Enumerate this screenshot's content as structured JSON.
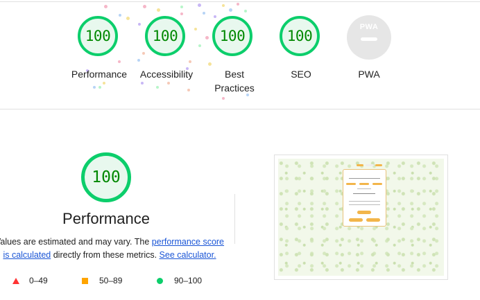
{
  "categories": [
    {
      "score": "100",
      "label": "Performance"
    },
    {
      "score": "100",
      "label": "Accessibility"
    },
    {
      "score": "100",
      "label": "Best Practices"
    },
    {
      "score": "100",
      "label": "SEO"
    }
  ],
  "pwa": {
    "badge": "PWA",
    "label": "PWA"
  },
  "performance": {
    "score": "100",
    "title": "Performance",
    "desc_part1": "Values are estimated and may vary. The ",
    "link1": "performance score is calculated",
    "desc_part2": " directly from these metrics. ",
    "link2": "See calculator."
  },
  "legend": [
    {
      "range": "0–49",
      "shape": "triangle",
      "color": "#ff3333"
    },
    {
      "range": "50–89",
      "shape": "square",
      "color": "#ffa400"
    },
    {
      "range": "90–100",
      "shape": "circle",
      "color": "#0cce6b"
    }
  ],
  "colors": {
    "pass": "#0cce6b",
    "pass_text": "#008800",
    "link": "#1a55d6"
  }
}
